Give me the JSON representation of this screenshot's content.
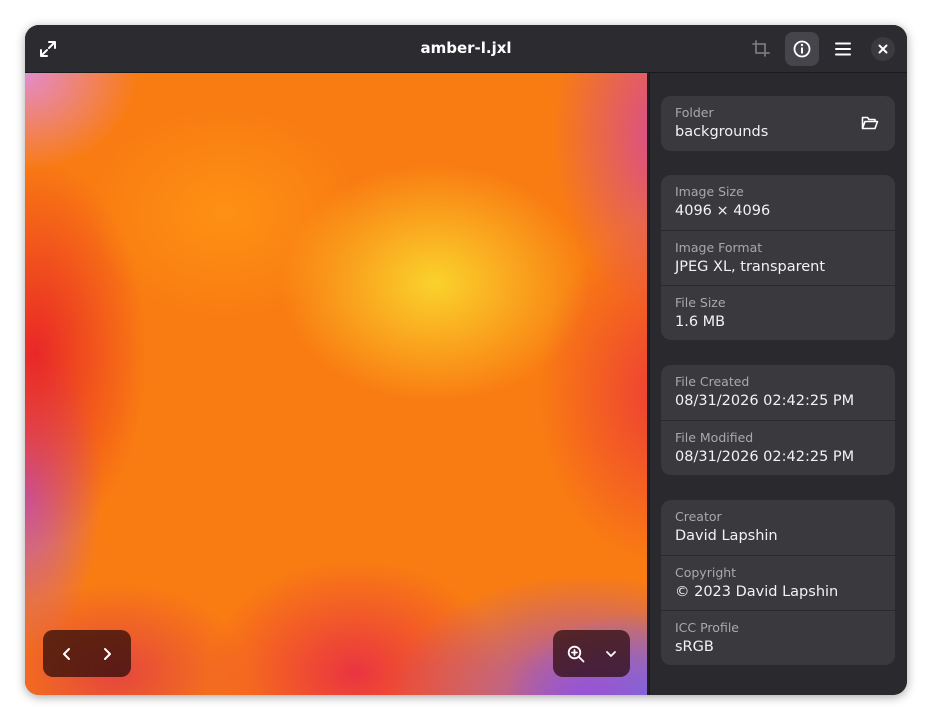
{
  "window": {
    "title": "amber-l.jxl"
  },
  "header": {
    "buttons": [
      "fullscreen-icon",
      "crop-icon",
      "info-icon",
      "hamburger-menu-icon",
      "close-icon"
    ],
    "active_button": "info-icon"
  },
  "osd": {
    "nav": [
      "chevron-left-icon",
      "chevron-right-icon"
    ],
    "zoom": [
      "zoom-in-icon",
      "chevron-down-icon"
    ]
  },
  "properties": {
    "folder": {
      "label": "Folder",
      "value": "backgrounds"
    },
    "image_size": {
      "label": "Image Size",
      "value": "4096 × 4096"
    },
    "image_format": {
      "label": "Image Format",
      "value": "JPEG XL, transparent"
    },
    "file_size": {
      "label": "File Size",
      "value": "1.6 MB"
    },
    "file_created": {
      "label": "File Created",
      "value": "08/31/2026 02:42:25 PM"
    },
    "file_modified": {
      "label": "File Modified",
      "value": "08/31/2026 02:42:25 PM"
    },
    "creator": {
      "label": "Creator",
      "value": "David Lapshin"
    },
    "copyright": {
      "label": "Copyright",
      "value": "© 2023 David Lapshin"
    },
    "icc_profile": {
      "label": "ICC Profile",
      "value": "sRGB"
    }
  },
  "colors": {
    "window_bg": "#222226",
    "headerbar_bg": "#2c2c30",
    "sidebar_bg": "#2a2a2e",
    "card_bg": "#3a3a3e",
    "label_text": "#a8a8ad",
    "value_text": "#f2f2f2"
  }
}
